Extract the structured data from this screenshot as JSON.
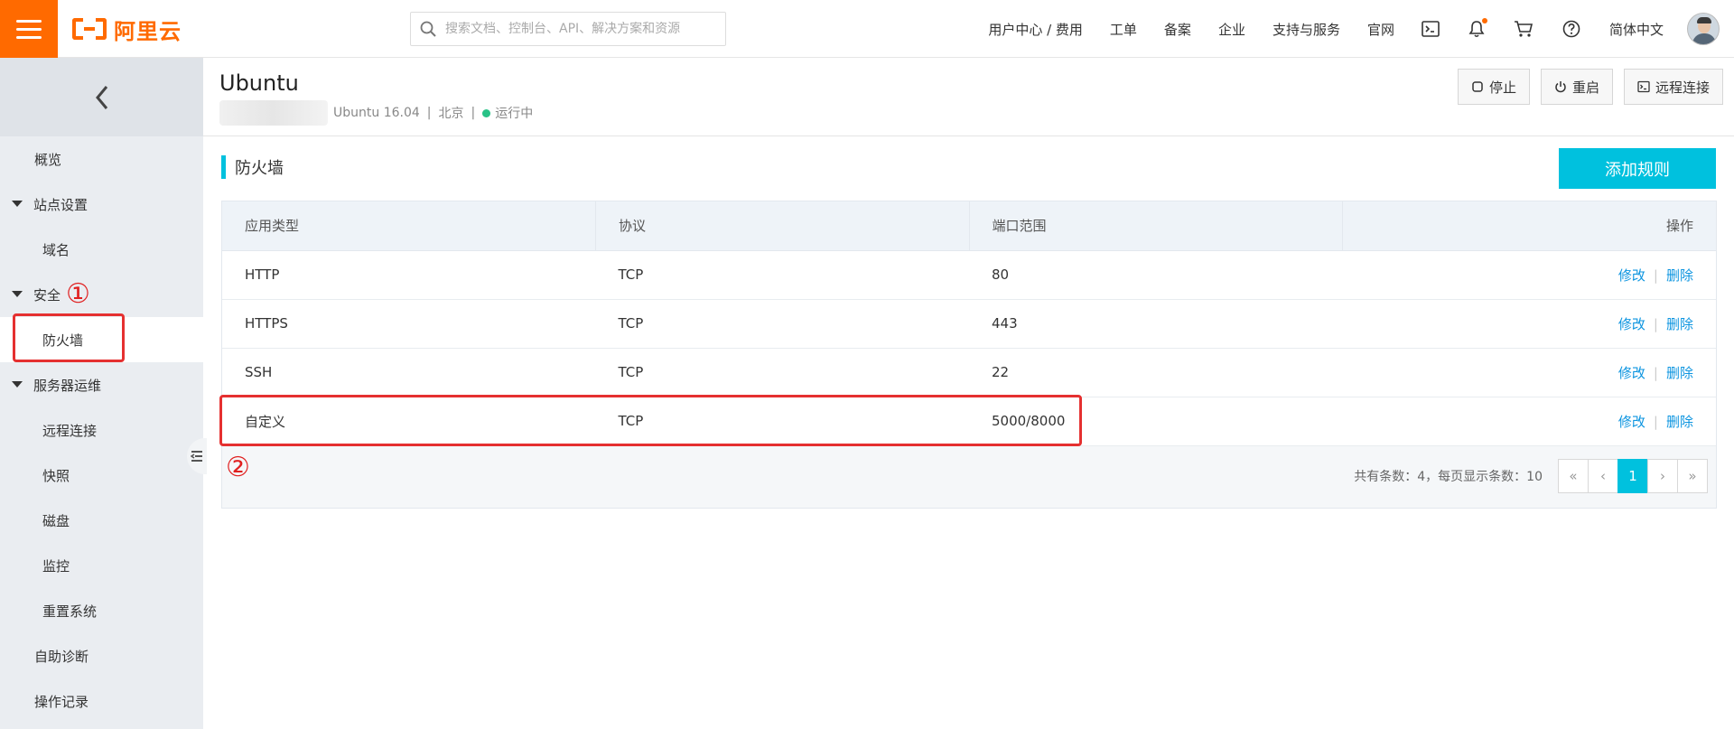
{
  "topbar": {
    "logo_text": "阿里云",
    "search_placeholder": "搜索文档、控制台、API、解决方案和资源",
    "nav": [
      "用户中心 / 费用",
      "工单",
      "备案",
      "企业",
      "支持与服务",
      "官网"
    ],
    "language": "简体中文"
  },
  "sidebar": {
    "items": [
      {
        "label": "概览",
        "type": "top"
      },
      {
        "label": "站点设置",
        "type": "group"
      },
      {
        "label": "域名",
        "type": "sub"
      },
      {
        "label": "安全",
        "type": "group",
        "annotation": "①"
      },
      {
        "label": "防火墙",
        "type": "sub",
        "active": true
      },
      {
        "label": "服务器运维",
        "type": "group"
      },
      {
        "label": "远程连接",
        "type": "sub"
      },
      {
        "label": "快照",
        "type": "sub"
      },
      {
        "label": "磁盘",
        "type": "sub"
      },
      {
        "label": "监控",
        "type": "sub"
      },
      {
        "label": "重置系统",
        "type": "sub"
      },
      {
        "label": "自助诊断",
        "type": "top"
      },
      {
        "label": "操作记录",
        "type": "top"
      }
    ]
  },
  "instance": {
    "title": "Ubuntu",
    "os": "Ubuntu 16.04",
    "region": "北京",
    "status": "运行中",
    "status_color": "#29c287",
    "buttons": {
      "stop": "停止",
      "restart": "重启",
      "remote": "远程连接"
    }
  },
  "firewall": {
    "title": "防火墙",
    "add_button": "添加规则",
    "columns": [
      "应用类型",
      "协议",
      "端口范围",
      "操作"
    ],
    "rows": [
      {
        "app": "HTTP",
        "protocol": "TCP",
        "port": "80",
        "edit": "修改",
        "delete": "删除"
      },
      {
        "app": "HTTPS",
        "protocol": "TCP",
        "port": "443",
        "edit": "修改",
        "delete": "删除"
      },
      {
        "app": "SSH",
        "protocol": "TCP",
        "port": "22",
        "edit": "修改",
        "delete": "删除"
      },
      {
        "app": "自定义",
        "protocol": "TCP",
        "port": "5000/8000",
        "edit": "修改",
        "delete": "删除"
      }
    ],
    "annotation": "②",
    "pager_info": "共有条数：4，每页显示条数：10",
    "pager": {
      "first": "«",
      "prev": "‹",
      "current": "1",
      "next": "›",
      "last": "»"
    }
  },
  "colors": {
    "accent": "#00c1de",
    "brand": "#ff6a00",
    "annotation": "#e53030"
  }
}
